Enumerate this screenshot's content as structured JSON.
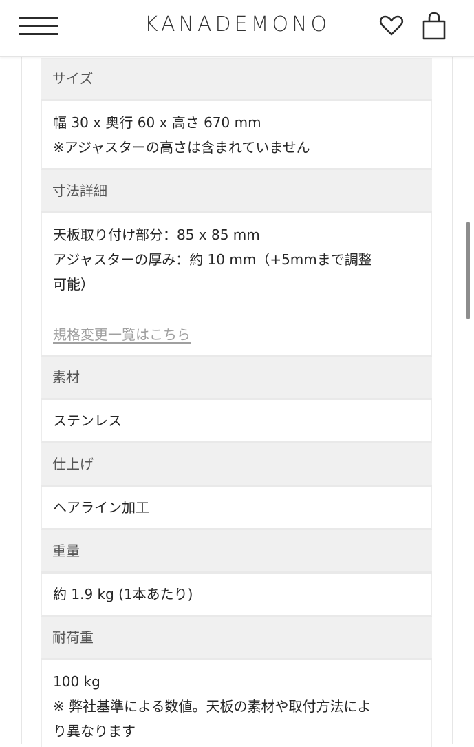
{
  "header": {
    "logo": "KANADEMONO",
    "menu_icon": "hamburger-menu-icon",
    "wishlist_icon": "heart-icon",
    "cart_icon": "shopping-bag-icon"
  },
  "specs": {
    "size_label": "サイズ",
    "size_line1": "幅 30 x 奥行 60 x 高さ 670 mm",
    "size_line2": "※アジャスターの高さは含まれていません",
    "dimensions_label": "寸法詳細",
    "dimensions_line1": "天板取り付け部分：85 x 85 mm",
    "dimensions_line2": "アジャスターの厚み：約 10 mm（+5mmまで調整",
    "dimensions_line3": "可能）",
    "dimensions_link": "規格変更一覧はこちら",
    "material_label": "素材",
    "material_value": "ステンレス",
    "finish_label": "仕上げ",
    "finish_value": "ヘアライン加工",
    "weight_label": "重量",
    "weight_value": "約 1.9 kg (1本あたり)",
    "load_label": "耐荷重",
    "load_line1": "100 kg",
    "load_line2": "※ 弊社基準による数値。天板の素材や取付方法によ",
    "load_line3": "り異なります"
  }
}
